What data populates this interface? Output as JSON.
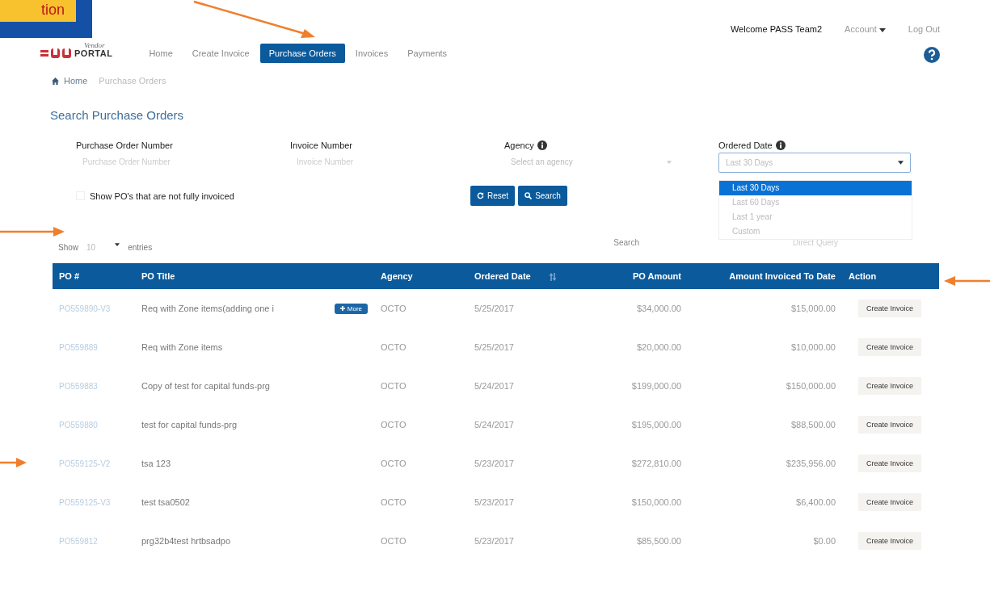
{
  "callout": {
    "text": "tion"
  },
  "header": {
    "logo_small": "Vendor",
    "logo": "PORTAL",
    "welcome": "Welcome PASS Team2",
    "account": "Account",
    "logout": "Log Out"
  },
  "nav": [
    {
      "label": "Home",
      "selected": false
    },
    {
      "label": "Create Invoice",
      "selected": false
    },
    {
      "label": "Purchase Orders",
      "selected": true
    },
    {
      "label": "Invoices",
      "selected": false
    },
    {
      "label": "Payments",
      "selected": false
    }
  ],
  "breadcrumb": [
    {
      "label": "Home"
    },
    {
      "label": "Purchase Orders"
    }
  ],
  "page_title": "Search Purchase Orders",
  "filters": [
    {
      "label": "Purchase Order Number",
      "placeholder": "Purchase Order Number",
      "info": false,
      "kind": "text"
    },
    {
      "label": "Invoice Number",
      "placeholder": "Invoice Number",
      "info": false,
      "kind": "text"
    },
    {
      "label": "Agency",
      "placeholder": "Select an agency",
      "info": true,
      "kind": "select"
    },
    {
      "label": "Ordered Date",
      "value": "Last 30 Days",
      "info": true,
      "kind": "dropdown",
      "options": [
        {
          "label": "Last 30 Days",
          "selected": true
        },
        {
          "label": "Last 60 Days",
          "selected": false
        },
        {
          "label": "Last 1 year",
          "selected": false
        },
        {
          "label": "Custom",
          "selected": false
        }
      ]
    }
  ],
  "not_fully_invoiced": {
    "label": "Show PO's that are not fully invoiced",
    "checked": false
  },
  "buttons": [
    {
      "label": "Reset",
      "kind": "reset"
    },
    {
      "label": "Search",
      "kind": "search"
    }
  ],
  "entries": {
    "show": "Show",
    "value": "10",
    "suffix": "entries"
  },
  "table_search": {
    "label": "Search",
    "placeholder": "Direct Query"
  },
  "table": {
    "columns": [
      {
        "label": "PO #",
        "sort": false
      },
      {
        "label": "PO Title",
        "sort": false
      },
      {
        "label": "Agency",
        "sort": false
      },
      {
        "label": "Ordered Date",
        "sort": true
      },
      {
        "label": "PO Amount",
        "sort": false
      },
      {
        "label": "Amount Invoiced To Date",
        "sort": false
      },
      {
        "label": "Action",
        "sort": false
      }
    ],
    "rows": [
      {
        "po": "PO559890-V3",
        "title": "Req with Zone items(adding one i",
        "more": "More",
        "agency": "OCTO",
        "date": "5/25/2017",
        "amount": "$34,000.00",
        "invoiced": "$15,000.00",
        "action": "Create Invoice"
      },
      {
        "po": "PO559889",
        "title": "Req with Zone items",
        "agency": "OCTO",
        "date": "5/25/2017",
        "amount": "$20,000.00",
        "invoiced": "$10,000.00",
        "action": "Create Invoice"
      },
      {
        "po": "PO559883",
        "title": "Copy of test for capital funds-prg",
        "agency": "OCTO",
        "date": "5/24/2017",
        "amount": "$199,000.00",
        "invoiced": "$150,000.00",
        "action": "Create Invoice"
      },
      {
        "po": "PO559880",
        "title": "test for capital funds-prg",
        "agency": "OCTO",
        "date": "5/24/2017",
        "amount": "$195,000.00",
        "invoiced": "$88,500.00",
        "action": "Create Invoice"
      },
      {
        "po": "PO559125-V2",
        "title": "tsa 123",
        "agency": "OCTO",
        "date": "5/23/2017",
        "amount": "$272,810.00",
        "invoiced": "$235,956.00",
        "action": "Create Invoice"
      },
      {
        "po": "PO559125-V3",
        "title": "test tsa0502",
        "agency": "OCTO",
        "date": "5/23/2017",
        "amount": "$150,000.00",
        "invoiced": "$6,400.00",
        "action": "Create Invoice"
      },
      {
        "po": "PO559812",
        "title": "prg32b4test hrtbsadpo",
        "agency": "OCTO",
        "date": "5/23/2017",
        "amount": "$85,500.00",
        "invoiced": "$0.00",
        "action": "Create Invoice"
      }
    ]
  }
}
